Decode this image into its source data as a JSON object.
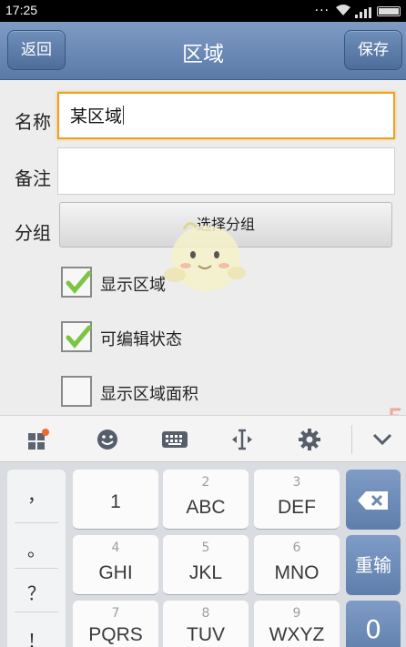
{
  "status": {
    "time": "17:25",
    "dots": "..."
  },
  "header": {
    "back_label": "返回",
    "title": "区域",
    "save_label": "保存"
  },
  "form": {
    "name_label": "名称",
    "name_value": "某区域",
    "note_label": "备注",
    "note_value": "",
    "group_label": "分组",
    "group_button": "选择分组",
    "checkboxes": [
      {
        "label": "显示区域",
        "checked": true
      },
      {
        "label": "可编辑状态",
        "checked": true
      },
      {
        "label": "显示区域面积",
        "checked": false
      }
    ]
  },
  "keyboard_toolbar": {
    "icons": [
      "apps-icon",
      "emoji-icon",
      "keyboard-icon",
      "cursor-icon",
      "settings-icon",
      "collapse-icon"
    ]
  },
  "keyboard": {
    "side_keys": [
      "，",
      "。",
      "？",
      "！"
    ],
    "keys": [
      {
        "num": "1",
        "letters": ""
      },
      {
        "num": "2",
        "letters": "ABC"
      },
      {
        "num": "3",
        "letters": "DEF"
      },
      {
        "num": "4",
        "letters": "GHI"
      },
      {
        "num": "5",
        "letters": "JKL"
      },
      {
        "num": "6",
        "letters": "MNO"
      },
      {
        "num": "7",
        "letters": "PQRS"
      },
      {
        "num": "8",
        "letters": "TUV"
      },
      {
        "num": "9",
        "letters": "WXYZ"
      }
    ],
    "reenter_label": "重输",
    "zero_label": "0"
  },
  "colors": {
    "titlebar": "#6a89b6",
    "focus_border": "#f0a020",
    "check_green": "#7cc442"
  }
}
